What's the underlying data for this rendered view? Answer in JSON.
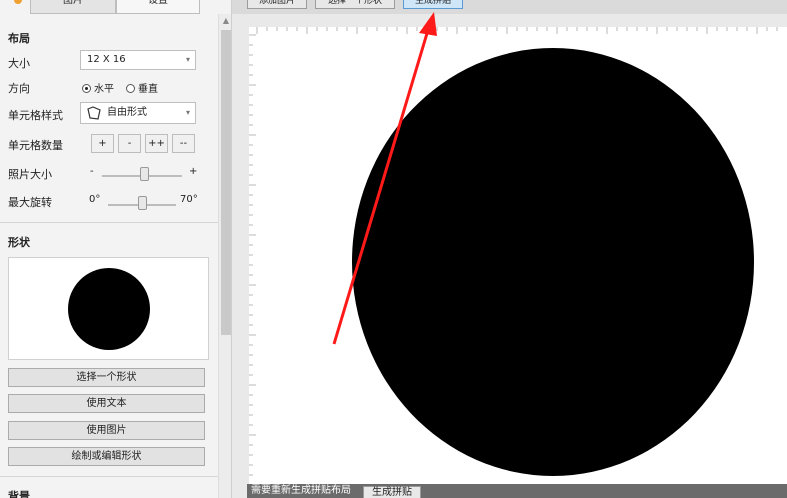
{
  "tabs": [
    {
      "label": "图片"
    },
    {
      "label": "设置"
    }
  ],
  "layout": {
    "section_title": "布局",
    "size_label": "大小",
    "size_value": "12 X 16",
    "direction_label": "方向",
    "direction_horizontal": "水平",
    "direction_vertical": "垂直",
    "direction_selected": "水平",
    "cell_style_label": "单元格样式",
    "cell_style_value": "自由形式",
    "cell_count_label": "单元格数量",
    "cell_count_buttons": [
      "+",
      "-",
      "++",
      "--"
    ],
    "photo_size_label": "照片大小",
    "photo_size_min": "-",
    "photo_size_max": "+",
    "photo_size_level": 0.54,
    "rotation_label": "最大旋转",
    "rotation_min": "0°",
    "rotation_max": "70°",
    "rotation_level": 0.5
  },
  "shape": {
    "section_title": "形状",
    "buttons": [
      "选择一个形状",
      "使用文本",
      "使用图片",
      "绘制或编辑形状"
    ]
  },
  "background": {
    "section_title": "背景"
  },
  "toolbar": {
    "buttons": [
      "添加图片",
      "选择一个形状",
      "生成拼贴"
    ],
    "highlighted_index": 2
  },
  "statusbar": {
    "message": "需要重新生成拼贴布局",
    "button_label": "生成拼贴"
  },
  "colors": {
    "annotation_arrow": "#ff1a1a",
    "highlight": "#cfe5f8",
    "shape_fill": "#000000"
  }
}
